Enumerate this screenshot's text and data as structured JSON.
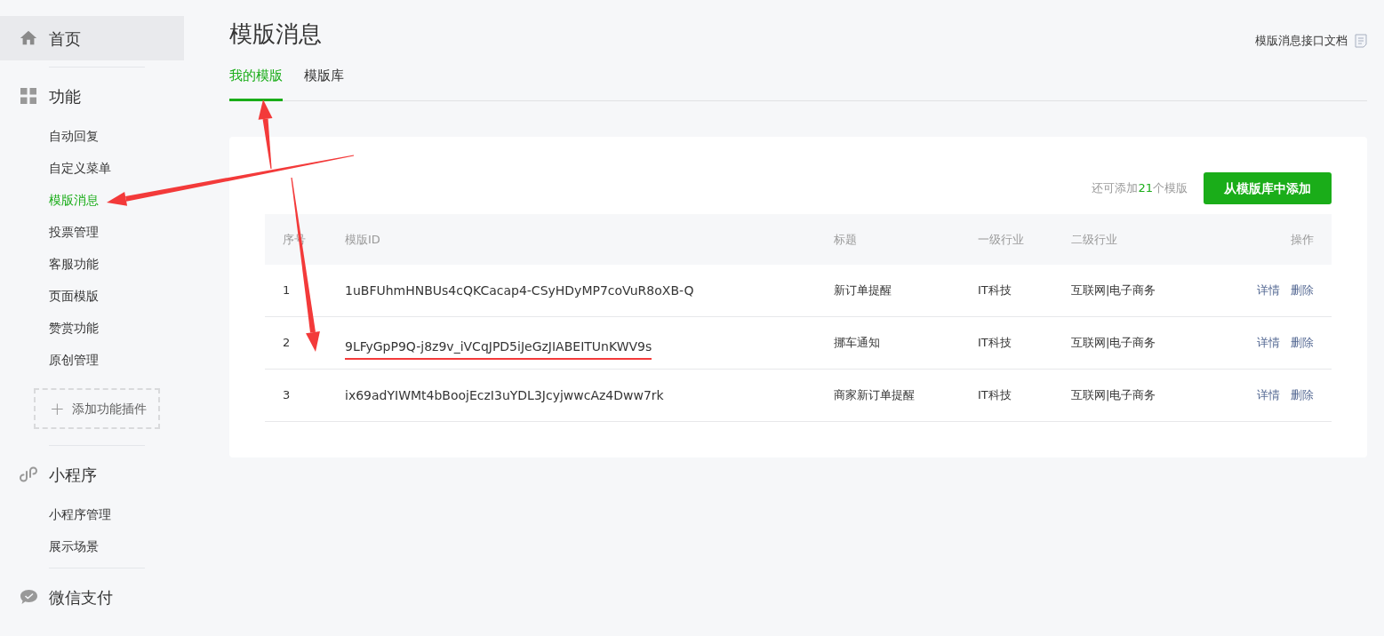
{
  "sidebar": {
    "sections": [
      {
        "title": "首页",
        "selected": true
      },
      {
        "title": "功能",
        "selected": false,
        "items": [
          {
            "label": "自动回复",
            "selected": false
          },
          {
            "label": "自定义菜单",
            "selected": false
          },
          {
            "label": "模版消息",
            "selected": true
          },
          {
            "label": "投票管理",
            "selected": false
          },
          {
            "label": "客服功能",
            "selected": false
          },
          {
            "label": "页面模版",
            "selected": false
          },
          {
            "label": "赞赏功能",
            "selected": false
          },
          {
            "label": "原创管理",
            "selected": false
          }
        ],
        "add_button": {
          "icon": "+",
          "label": "添加功能插件"
        }
      },
      {
        "title": "小程序",
        "selected": false,
        "items": [
          {
            "label": "小程序管理",
            "selected": false
          },
          {
            "label": "展示场景",
            "selected": false
          }
        ]
      },
      {
        "title": "微信支付",
        "selected": false
      }
    ]
  },
  "page": {
    "title": "模版消息",
    "doc_link": "模版消息接口文档",
    "tabs": [
      {
        "label": "我的模版",
        "selected": true
      },
      {
        "label": "模版库",
        "selected": false
      }
    ],
    "quota": {
      "prefix": "还可添加",
      "count": "21",
      "suffix": "个模版"
    },
    "add_button": "从模版库中添加",
    "table": {
      "columns": [
        "序号",
        "模版ID",
        "标题",
        "一级行业",
        "二级行业",
        "操作"
      ],
      "rows": [
        {
          "index": "1",
          "template_id": "1uBFUhmHNBUs4cQKCacap4-CSyHDyMP7coVuR8oXB-Q",
          "title": "新订单提醒",
          "industry_1": "IT科技",
          "industry_2": "互联网|电子商务",
          "actions": [
            "详情",
            "删除"
          ],
          "underlined": false
        },
        {
          "index": "2",
          "template_id": "9LFyGpP9Q-j8z9v_iVCqJPD5iJeGzJIABEITUnKWV9s",
          "title": "挪车通知",
          "industry_1": "IT科技",
          "industry_2": "互联网|电子商务",
          "actions": [
            "详情",
            "删除"
          ],
          "underlined": true
        },
        {
          "index": "3",
          "template_id": "ix69adYIWMt4bBoojEczI3uYDL3JcyjwwcAz4Dww7rk",
          "title": "商家新订单提醒",
          "industry_1": "IT科技",
          "industry_2": "互联网|电子商务",
          "actions": [
            "详情",
            "删除"
          ],
          "underlined": false
        }
      ]
    }
  },
  "annotations": [
    {
      "kind": "arrow"
    },
    {
      "kind": "arrow"
    },
    {
      "kind": "arrow"
    }
  ]
}
